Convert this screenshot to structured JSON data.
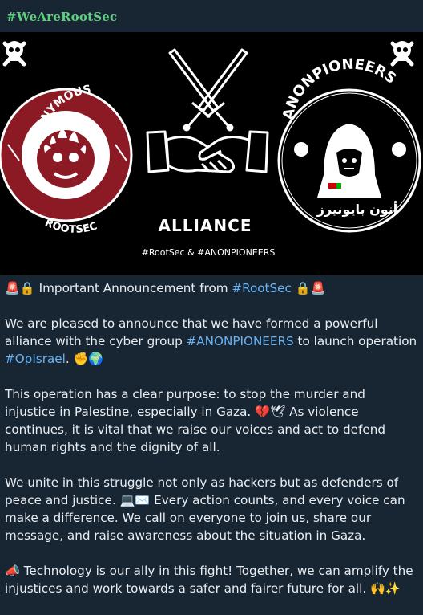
{
  "channel_hashtag": "#WeAreRootSec",
  "banner": {
    "left_logo_top_text": "ANONYMOUS",
    "left_logo_bottom_text": "ROOTSEC",
    "right_logo_text": "ANONPIONEERS",
    "right_logo_arabic": "أنون بايونيرز",
    "center_title": "ALLIANCE",
    "center_subtitle": "#RootSec & #ANONPIONEERS"
  },
  "message": {
    "headline_emoji_left": "🚨🔒",
    "headline_text": " Important Announcement from ",
    "headline_hashtag": "#RootSec",
    "headline_emoji_right": " 🔒🚨",
    "p1_a": "We are pleased to announce that we have formed a powerful alliance with the cyber group ",
    "p1_hashtag1": "#ANONPIONEERS",
    "p1_b": " to launch operation ",
    "p1_hashtag2": "#OpIsrael",
    "p1_c": ". ✊🌍",
    "p2": "This operation has a clear purpose: to stop the murder and injustice in Palestine, especially in Gaza. 💔🕊 As violence continues, it is vital that we raise our voices and act to defend human rights and the dignity of all.",
    "p3": "We unite in this struggle not only as hackers but as defenders of peace and justice. 💻✉️ Every action counts, and every voice can make a difference. We call on everyone to join us, share our message, and raise awareness about the situation in Gaza.",
    "p4": "📣 Technology is our ally in this fight! Together, we can amplify the injustices and work towards a safer and fairer future for all. 🙌✨"
  },
  "colors": {
    "background": "#182533",
    "hashtag_link": "#6ab3f3",
    "channel_tag": "#5fcf80",
    "rootsec_logo": "#8b1a24"
  }
}
